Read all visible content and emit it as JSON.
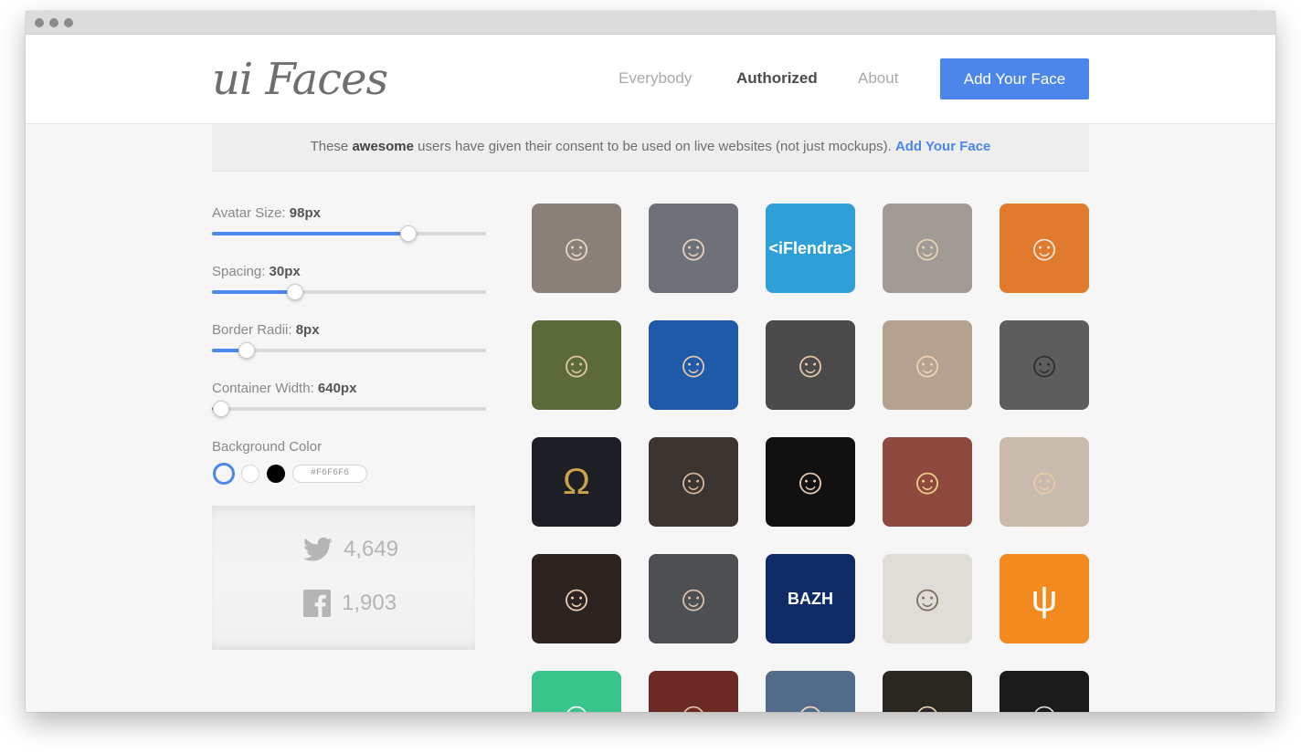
{
  "logo": "ui Faces",
  "nav": {
    "items": [
      {
        "label": "Everybody",
        "active": false
      },
      {
        "label": "Authorized",
        "active": true
      },
      {
        "label": "About",
        "active": false
      }
    ],
    "cta_label": "Add Your Face"
  },
  "notice": {
    "prefix": "These ",
    "bold": "awesome",
    "middle": " users have given their consent to be used on live websites (not just mockups). ",
    "link": "Add Your Face"
  },
  "controls": {
    "avatar_size": {
      "label": "Avatar Size:",
      "value": "98px",
      "fraction": 0.715
    },
    "spacing": {
      "label": "Spacing:",
      "value": "30px",
      "fraction": 0.303
    },
    "border_radii": {
      "label": "Border Radii:",
      "value": "8px",
      "fraction": 0.127
    },
    "container_width": {
      "label": "Container Width:",
      "value": "640px",
      "fraction": 0.033
    }
  },
  "background": {
    "label": "Background Color",
    "swatches": [
      "#f6f6f6",
      "#ffffff",
      "#000000"
    ],
    "selected": 0,
    "hex_value": "#F6F6F6"
  },
  "social": {
    "twitter_count": "4,649",
    "facebook_count": "1,903"
  },
  "avatars": [
    {
      "bg": "#8a8078",
      "glyph": "☺",
      "color": "#e9d6c4"
    },
    {
      "bg": "#6e7177",
      "glyph": "☺",
      "color": "#e8d3c0"
    },
    {
      "bg": "#2f9fd8",
      "text": "<iFlendra>",
      "color": "#ffffff"
    },
    {
      "bg": "#a09c95",
      "glyph": "☺",
      "color": "#e7d2bb"
    },
    {
      "bg": "#e07a2c",
      "glyph": "☺",
      "color": "#f4e9dd"
    },
    {
      "bg": "#5c6a3a",
      "glyph": "☺",
      "color": "#e0c9a6"
    },
    {
      "bg": "#1f5aa8",
      "glyph": "☺",
      "color": "#eac8a9"
    },
    {
      "bg": "#4a4a4a",
      "glyph": "☺",
      "color": "#e7c9aa"
    },
    {
      "bg": "#b5a290",
      "glyph": "☺",
      "color": "#f1d2b5"
    },
    {
      "bg": "#5d5d5d",
      "glyph": "☺",
      "color": "#2e2e2e"
    },
    {
      "bg": "#1d1f24",
      "glyph": "Ω",
      "color": "#c9a24b"
    },
    {
      "bg": "#3b3531",
      "glyph": "☺",
      "color": "#d8b89c"
    },
    {
      "bg": "#111111",
      "glyph": "☺",
      "color": "#e6cdb6"
    },
    {
      "bg": "#8e4a3e",
      "glyph": "☺",
      "color": "#f2d08a"
    },
    {
      "bg": "#c9bcae",
      "glyph": "☺",
      "color": "#e8c9ab"
    },
    {
      "bg": "#2d2320",
      "glyph": "☺",
      "color": "#ecd0b8"
    },
    {
      "bg": "#4e4f52",
      "glyph": "☺",
      "color": "#d9c2ae"
    },
    {
      "bg": "#0e2b66",
      "text": "BAZH",
      "color": "#ffffff"
    },
    {
      "bg": "#e0dcd8",
      "glyph": "☺",
      "color": "#7a6b5c"
    },
    {
      "bg": "#f28a1f",
      "glyph": "ψ",
      "color": "#ffffff"
    },
    {
      "bg": "#39c48c",
      "glyph": "☺",
      "color": "#ffffff"
    },
    {
      "bg": "#6b2b24",
      "glyph": "☺",
      "color": "#e1c1a7"
    },
    {
      "bg": "#516b88",
      "glyph": "☺",
      "color": "#f0d8c2"
    },
    {
      "bg": "#2a2622",
      "glyph": "☺",
      "color": "#e9cfb3"
    },
    {
      "bg": "#1a1a1a",
      "glyph": "☺",
      "color": "#d8d8d8"
    }
  ],
  "colors": {
    "accent": "#4d86ea",
    "page_bg": "#f6f6f6"
  }
}
